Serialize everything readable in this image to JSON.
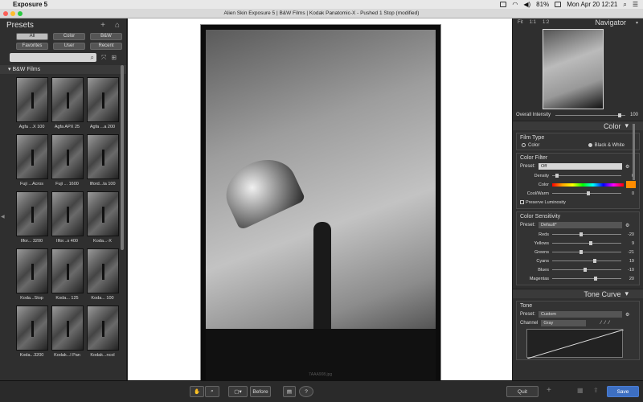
{
  "menubar": {
    "app": "Exposure 5",
    "battery": "81%",
    "datetime": "Mon Apr 20  12:21"
  },
  "window": {
    "title": "Alien Skin Exposure 5 | B&W Films | Kodak Panatomic-X - Pushed 1 Stop (modified)"
  },
  "presets": {
    "title": "Presets",
    "filters": [
      "All",
      "Color",
      "B&W",
      "Favorites",
      "User",
      "Recent"
    ],
    "group": "B&W Films",
    "thumbs": [
      "Agfa ...X 100",
      "Agfa APX 25",
      "Agfa ...a 200",
      "Fuji ...Acros",
      "Fuji ... 1600",
      "Ilford...ta 100",
      "Ilfor... 3200",
      "Ilfor...s 400",
      "Koda...-X",
      "Koda...Stop",
      "Koda... 125",
      "Koda... 100",
      "Koda...3200",
      "Kodak...l Pan",
      "Kodak...ncol"
    ]
  },
  "canvas": {
    "filename": "7AAA908.jpg"
  },
  "navigator": {
    "title": "Navigator",
    "zoom": [
      "Fit",
      "1:1",
      "1:2"
    ],
    "overall_intensity_label": "Overall Intensity",
    "overall_intensity": "100"
  },
  "color_panel": {
    "title": "Color",
    "film_type": {
      "label": "Film Type",
      "options": [
        "Color",
        "Black & White"
      ],
      "selected": "Black & White"
    },
    "color_filter": {
      "label": "Color Filter",
      "preset_label": "Preset:",
      "preset": "Off",
      "density_label": "Density",
      "density": "0",
      "color_label": "Color",
      "coolwarm_label": "Cool/Warm",
      "coolwarm": "0",
      "preserve_label": "Preserve Luminosity",
      "accent": "#ff8c00"
    },
    "color_sensitivity": {
      "label": "Color Sensitivity",
      "preset_label": "Preset:",
      "preset": "Default*",
      "rows": [
        {
          "name": "Reds",
          "value": "-20"
        },
        {
          "name": "Yellows",
          "value": "9"
        },
        {
          "name": "Greens",
          "value": "-21"
        },
        {
          "name": "Cyans",
          "value": "19"
        },
        {
          "name": "Blues",
          "value": "-10"
        },
        {
          "name": "Magentas",
          "value": "20"
        }
      ]
    }
  },
  "tone_panel": {
    "title": "Tone Curve",
    "box_label": "Tone",
    "preset_label": "Preset:",
    "preset": "Custom",
    "channel_label": "Channel",
    "channel": "Gray"
  },
  "toolbar": {
    "before_label": "Before",
    "quit_label": "Quit",
    "save_label": "Save"
  }
}
